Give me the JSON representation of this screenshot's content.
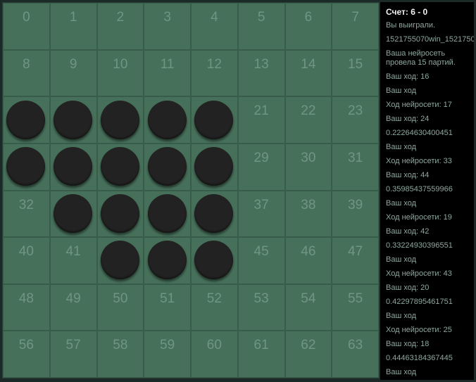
{
  "board": {
    "cells": [
      {
        "n": "0"
      },
      {
        "n": "1"
      },
      {
        "n": "2"
      },
      {
        "n": "3"
      },
      {
        "n": "4"
      },
      {
        "n": "5"
      },
      {
        "n": "6"
      },
      {
        "n": "7"
      },
      {
        "n": "8"
      },
      {
        "n": "9"
      },
      {
        "n": "10"
      },
      {
        "n": "11"
      },
      {
        "n": "12"
      },
      {
        "n": "13"
      },
      {
        "n": "14"
      },
      {
        "n": "15"
      },
      {
        "n": "",
        "piece": "black"
      },
      {
        "n": "",
        "piece": "black"
      },
      {
        "n": "",
        "piece": "black"
      },
      {
        "n": "",
        "piece": "black"
      },
      {
        "n": "",
        "piece": "black"
      },
      {
        "n": "21"
      },
      {
        "n": "22"
      },
      {
        "n": "23"
      },
      {
        "n": "",
        "piece": "black"
      },
      {
        "n": "",
        "piece": "black"
      },
      {
        "n": "",
        "piece": "black"
      },
      {
        "n": "",
        "piece": "black"
      },
      {
        "n": "",
        "piece": "black"
      },
      {
        "n": "29"
      },
      {
        "n": "30"
      },
      {
        "n": "31"
      },
      {
        "n": "32"
      },
      {
        "n": "",
        "piece": "black"
      },
      {
        "n": "",
        "piece": "black"
      },
      {
        "n": "",
        "piece": "black"
      },
      {
        "n": "",
        "piece": "black"
      },
      {
        "n": "37"
      },
      {
        "n": "38"
      },
      {
        "n": "39"
      },
      {
        "n": "40"
      },
      {
        "n": "41"
      },
      {
        "n": "",
        "piece": "black"
      },
      {
        "n": "",
        "piece": "black"
      },
      {
        "n": "",
        "piece": "black"
      },
      {
        "n": "45"
      },
      {
        "n": "46"
      },
      {
        "n": "47"
      },
      {
        "n": "48"
      },
      {
        "n": "49"
      },
      {
        "n": "50"
      },
      {
        "n": "51"
      },
      {
        "n": "52"
      },
      {
        "n": "53"
      },
      {
        "n": "54"
      },
      {
        "n": "55"
      },
      {
        "n": "56"
      },
      {
        "n": "57"
      },
      {
        "n": "58"
      },
      {
        "n": "59"
      },
      {
        "n": "60"
      },
      {
        "n": "61"
      },
      {
        "n": "62"
      },
      {
        "n": "63"
      }
    ]
  },
  "sidebar": {
    "score": "Счет: 6 - 0",
    "log": [
      "Вы выиграли.",
      "1521755070win_1521750",
      "Ваша нейросеть провела 15 партий.",
      "Ваш ход: 16",
      "Ваш ход",
      "Ход нейросети: 17",
      "Ваш ход: 24",
      "0.22264630400451",
      "Ваш ход",
      "Ход нейросети: 33",
      "Ваш ход: 44",
      "0.35985437559966",
      "Ваш ход",
      "Ход нейросети: 19",
      "Ваш ход: 42",
      "0.33224930396551",
      "Ваш ход",
      "Ход нейросети: 43",
      "Ваш ход: 20",
      "0.42297895461751",
      "Ваш ход",
      "Ход нейросети: 25",
      "Ваш ход: 18",
      "0.44463184367445",
      "Ваш ход"
    ]
  },
  "colors": {
    "cell": "#47705a",
    "cell_number": "#6e9683",
    "piece_black": "#222222",
    "panel_bg": "#000000",
    "log_text": "#8ea89e"
  }
}
